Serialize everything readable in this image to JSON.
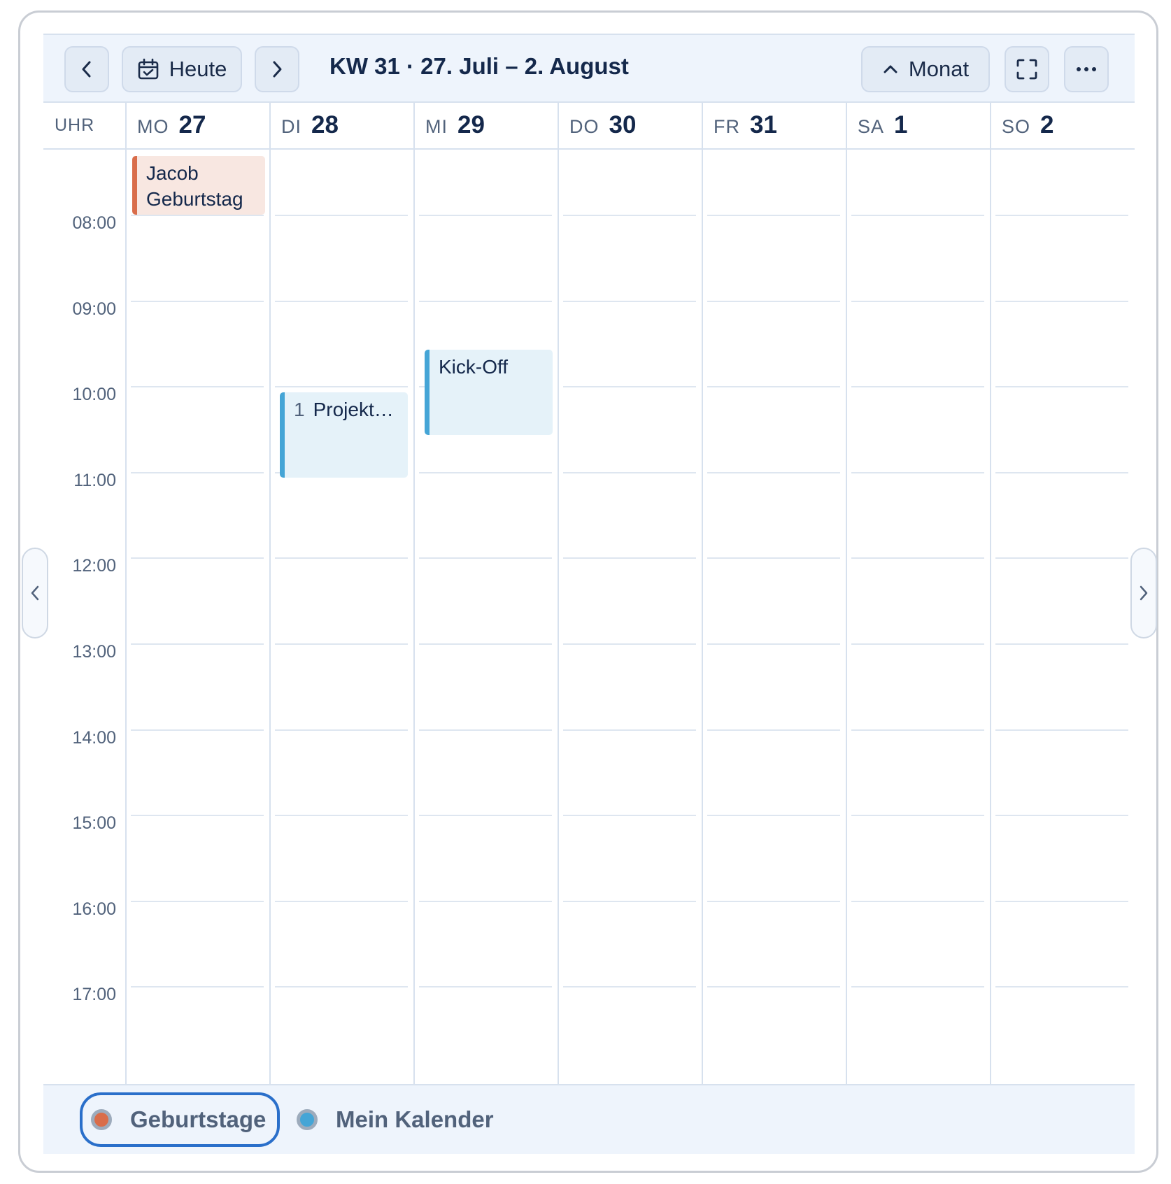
{
  "toolbar": {
    "today_label": "Heute",
    "week_title": "KW 31 · 27. Juli – 2. August",
    "view_label": "Monat"
  },
  "grid": {
    "time_column_label": "UHR",
    "days": [
      {
        "name": "MO",
        "date": "27"
      },
      {
        "name": "DI",
        "date": "28"
      },
      {
        "name": "MI",
        "date": "29"
      },
      {
        "name": "DO",
        "date": "30"
      },
      {
        "name": "FR",
        "date": "31"
      },
      {
        "name": "SA",
        "date": "1"
      },
      {
        "name": "SO",
        "date": "2"
      }
    ],
    "hours": [
      "08:00",
      "09:00",
      "10:00",
      "11:00",
      "12:00",
      "13:00",
      "14:00",
      "15:00",
      "16:00",
      "17:00"
    ]
  },
  "events": [
    {
      "title": "Jacob Geburtstag",
      "day": "MO",
      "calendar": "Geburtstage",
      "all_day": true
    },
    {
      "count": "1",
      "title": "Projekt…",
      "day": "DI",
      "start": "10:00",
      "end": "11:00",
      "calendar": "Mein Kalender"
    },
    {
      "title": "Kick-Off",
      "day": "MI",
      "start": "09:30",
      "end": "10:30",
      "calendar": "Mein Kalender"
    }
  ],
  "legend": [
    {
      "label": "Geburtstage",
      "color": "#d96d4a",
      "active": true
    },
    {
      "label": "Mein Kalender",
      "color": "#45a5d6",
      "active": false
    }
  ],
  "colors": {
    "accent": "#2a6fca",
    "birthday": "#d96d4a",
    "my_calendar": "#45a5d6",
    "toolbar_bg": "#eef4fc"
  },
  "icons": {
    "prev": "chevron-left-icon",
    "today": "calendar-check-icon",
    "next": "chevron-right-icon",
    "view": "chevron-up-icon",
    "fullscreen": "fullscreen-icon",
    "more": "more-horizontal-icon"
  }
}
